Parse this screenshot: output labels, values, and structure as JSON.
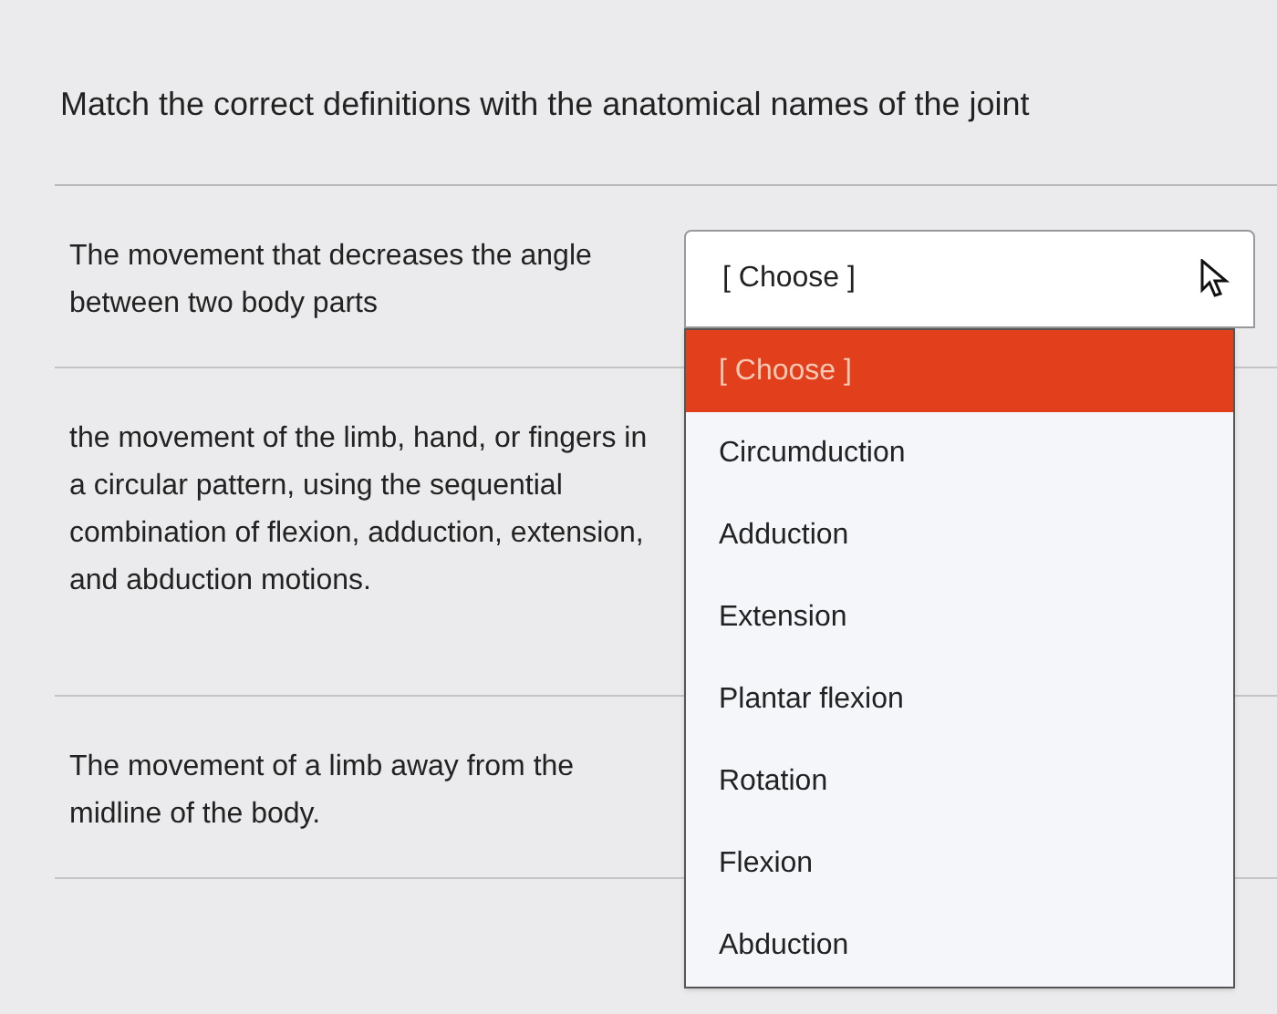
{
  "question": {
    "title": "Match the correct definitions with the anatomical names of the joint"
  },
  "rows": [
    {
      "definition": "The movement that decreases the angle between two body parts",
      "select": {
        "value": "[ Choose ]",
        "expanded": true
      }
    },
    {
      "definition": "the movement of the limb, hand, or fingers in a circular pattern, using the sequential combination of flexion, adduction, extension, and abduction motions."
    },
    {
      "definition": "The movement of a limb away from the midline of the body."
    }
  ],
  "dropdown": {
    "options": [
      {
        "label": "[ Choose ]",
        "selected": true
      },
      {
        "label": "Circumduction",
        "selected": false
      },
      {
        "label": "Adduction",
        "selected": false
      },
      {
        "label": "Extension",
        "selected": false
      },
      {
        "label": "Plantar flexion",
        "selected": false
      },
      {
        "label": "Rotation",
        "selected": false
      },
      {
        "label": "Flexion",
        "selected": false
      },
      {
        "label": "Abduction",
        "selected": false
      }
    ]
  }
}
